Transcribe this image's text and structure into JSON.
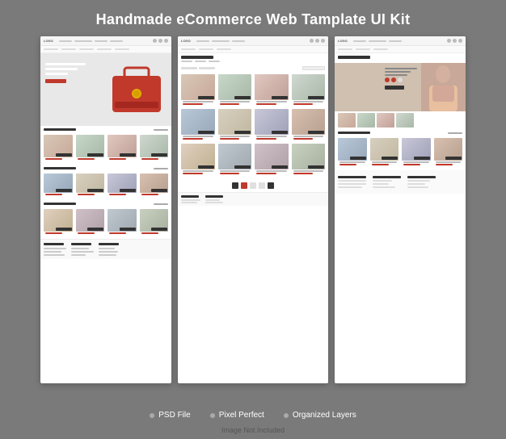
{
  "page": {
    "title": "Handmade eCommerce Web Tamplate UI Kit",
    "background_color": "#7a7a7a"
  },
  "badges": [
    {
      "label": "PSD File",
      "id": "psd-file"
    },
    {
      "label": "Pixel Perfect",
      "id": "pixel-perfect"
    },
    {
      "label": "Organized Layers",
      "id": "organized-layers"
    }
  ],
  "bottom_note": "Image Not Included",
  "cards": {
    "left": {
      "nav": {
        "logo": "LOGO"
      },
      "page_type": "Homepage"
    },
    "center": {
      "nav": {
        "logo": "LOGO"
      },
      "page_type": "Clutch Bag",
      "page_title": "Clutch Bag"
    },
    "right": {
      "nav": {
        "logo": "LOGO"
      },
      "page_type": "Product Detail",
      "page_title": "Product Detail"
    }
  }
}
